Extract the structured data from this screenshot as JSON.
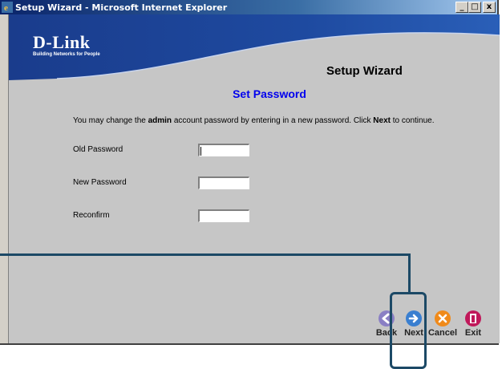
{
  "window": {
    "title": "Setup Wizard - Microsoft Internet Explorer",
    "min_label": "_",
    "max_label": "□",
    "close_label": "x"
  },
  "header": {
    "brand": "D-Link",
    "tagline": "Building Networks for People",
    "title": "Setup Wizard"
  },
  "page": {
    "heading": "Set Password",
    "instruction_prefix": "You may change the ",
    "instruction_bold1": "admin",
    "instruction_mid": " account password by entering in a new password. Click ",
    "instruction_bold2": "Next",
    "instruction_suffix": " to continue."
  },
  "form": {
    "old_password_label": "Old Password",
    "old_password_value": "",
    "new_password_label": "New Password",
    "new_password_value": "",
    "reconfirm_label": "Reconfirm",
    "reconfirm_value": ""
  },
  "nav": {
    "back_label": "Back",
    "next_label": "Next",
    "cancel_label": "Cancel",
    "exit_label": "Exit"
  },
  "colors": {
    "header_blue": "#1a3c8c",
    "heading_blue": "#0000ee",
    "callout": "#1c4966"
  }
}
